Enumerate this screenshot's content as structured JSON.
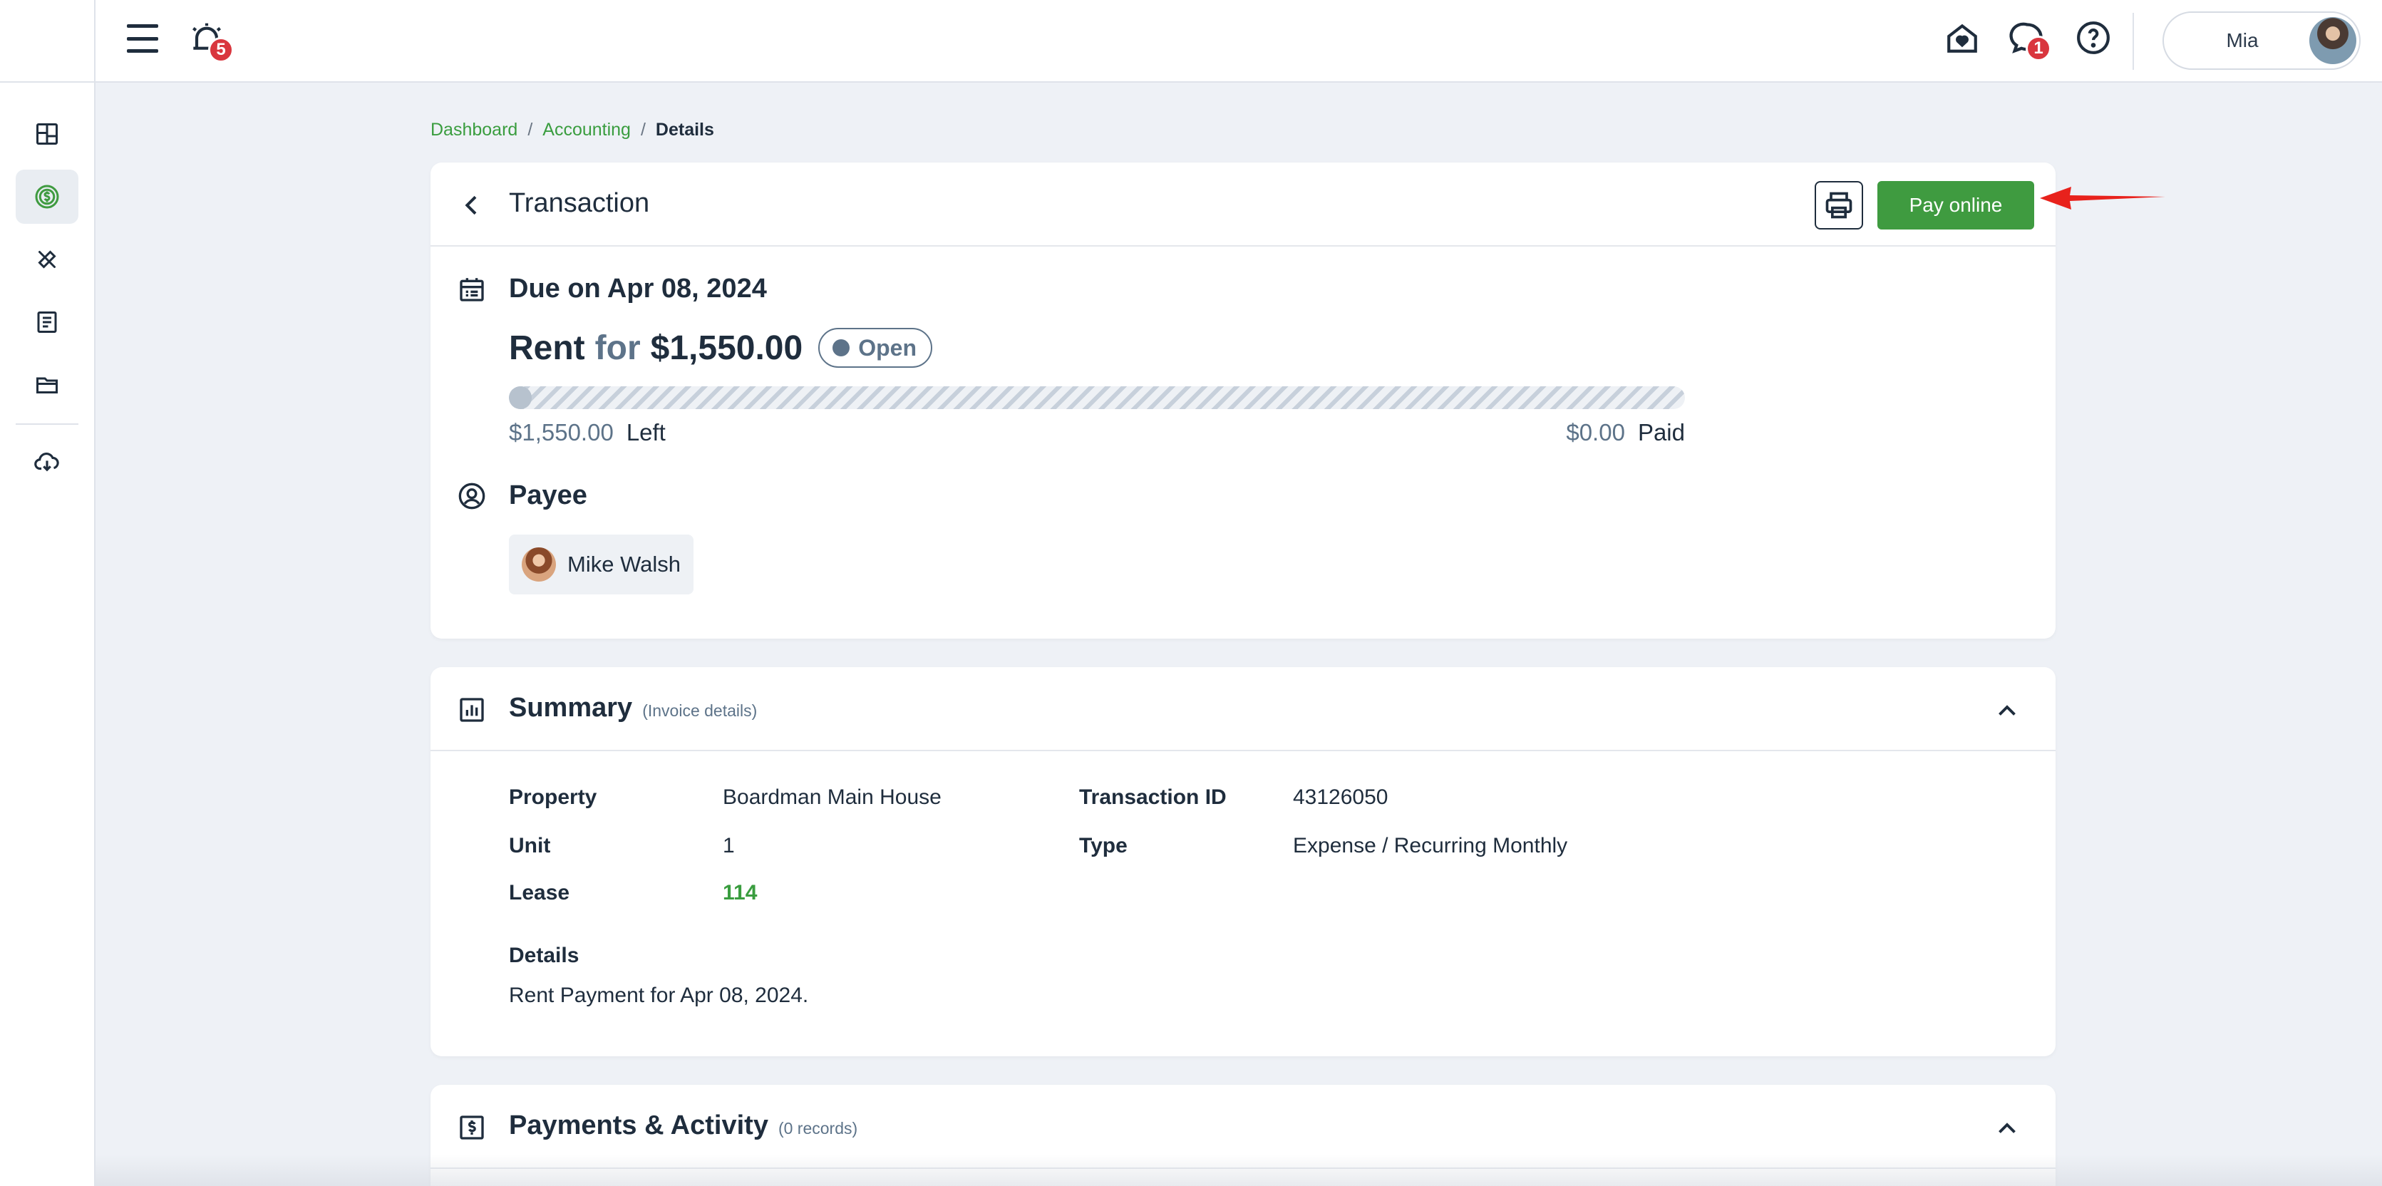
{
  "topbar": {
    "notifications_count": "5",
    "messages_count": "1",
    "user_name": "Mia"
  },
  "sidebar": {
    "items": [
      {
        "icon": "dashboard-icon",
        "active": false
      },
      {
        "icon": "dollar-icon",
        "active": true
      },
      {
        "icon": "tools-icon",
        "active": false
      },
      {
        "icon": "document-icon",
        "active": false
      },
      {
        "icon": "folder-icon",
        "active": false
      },
      {
        "icon": "download-cloud-icon",
        "active": false
      }
    ]
  },
  "breadcrumb": {
    "items": [
      "Dashboard",
      "Accounting",
      "Details"
    ],
    "separator": "/"
  },
  "transaction": {
    "title": "Transaction",
    "pay_label": "Pay online",
    "due_text": "Due on Apr 08, 2024",
    "category": "Rent",
    "for_word": "for",
    "amount": "$1,550.00",
    "status": "Open",
    "paid_fraction": 0,
    "left_amount": "$1,550.00",
    "left_label": "Left",
    "paid_amount": "$0.00",
    "paid_label": "Paid",
    "payee_title": "Payee",
    "payee_name": "Mike Walsh"
  },
  "summary": {
    "title": "Summary",
    "subtitle": "(Invoice details)",
    "property_label": "Property",
    "property_value": "Boardman Main House",
    "unit_label": "Unit",
    "unit_value": "1",
    "lease_label": "Lease",
    "lease_value": "114",
    "transaction_id_label": "Transaction ID",
    "transaction_id_value": "43126050",
    "type_label": "Type",
    "type_value": "Expense / Recurring Monthly",
    "details_label": "Details",
    "details_value": "Rent Payment for Apr 08, 2024."
  },
  "payments": {
    "title": "Payments & Activity",
    "subtitle": "(0 records)"
  },
  "colors": {
    "accent_green": "#3f9b40",
    "status_gray": "#5d7389",
    "badge_red": "#d9363e",
    "annotation_arrow": "#e8221c"
  }
}
